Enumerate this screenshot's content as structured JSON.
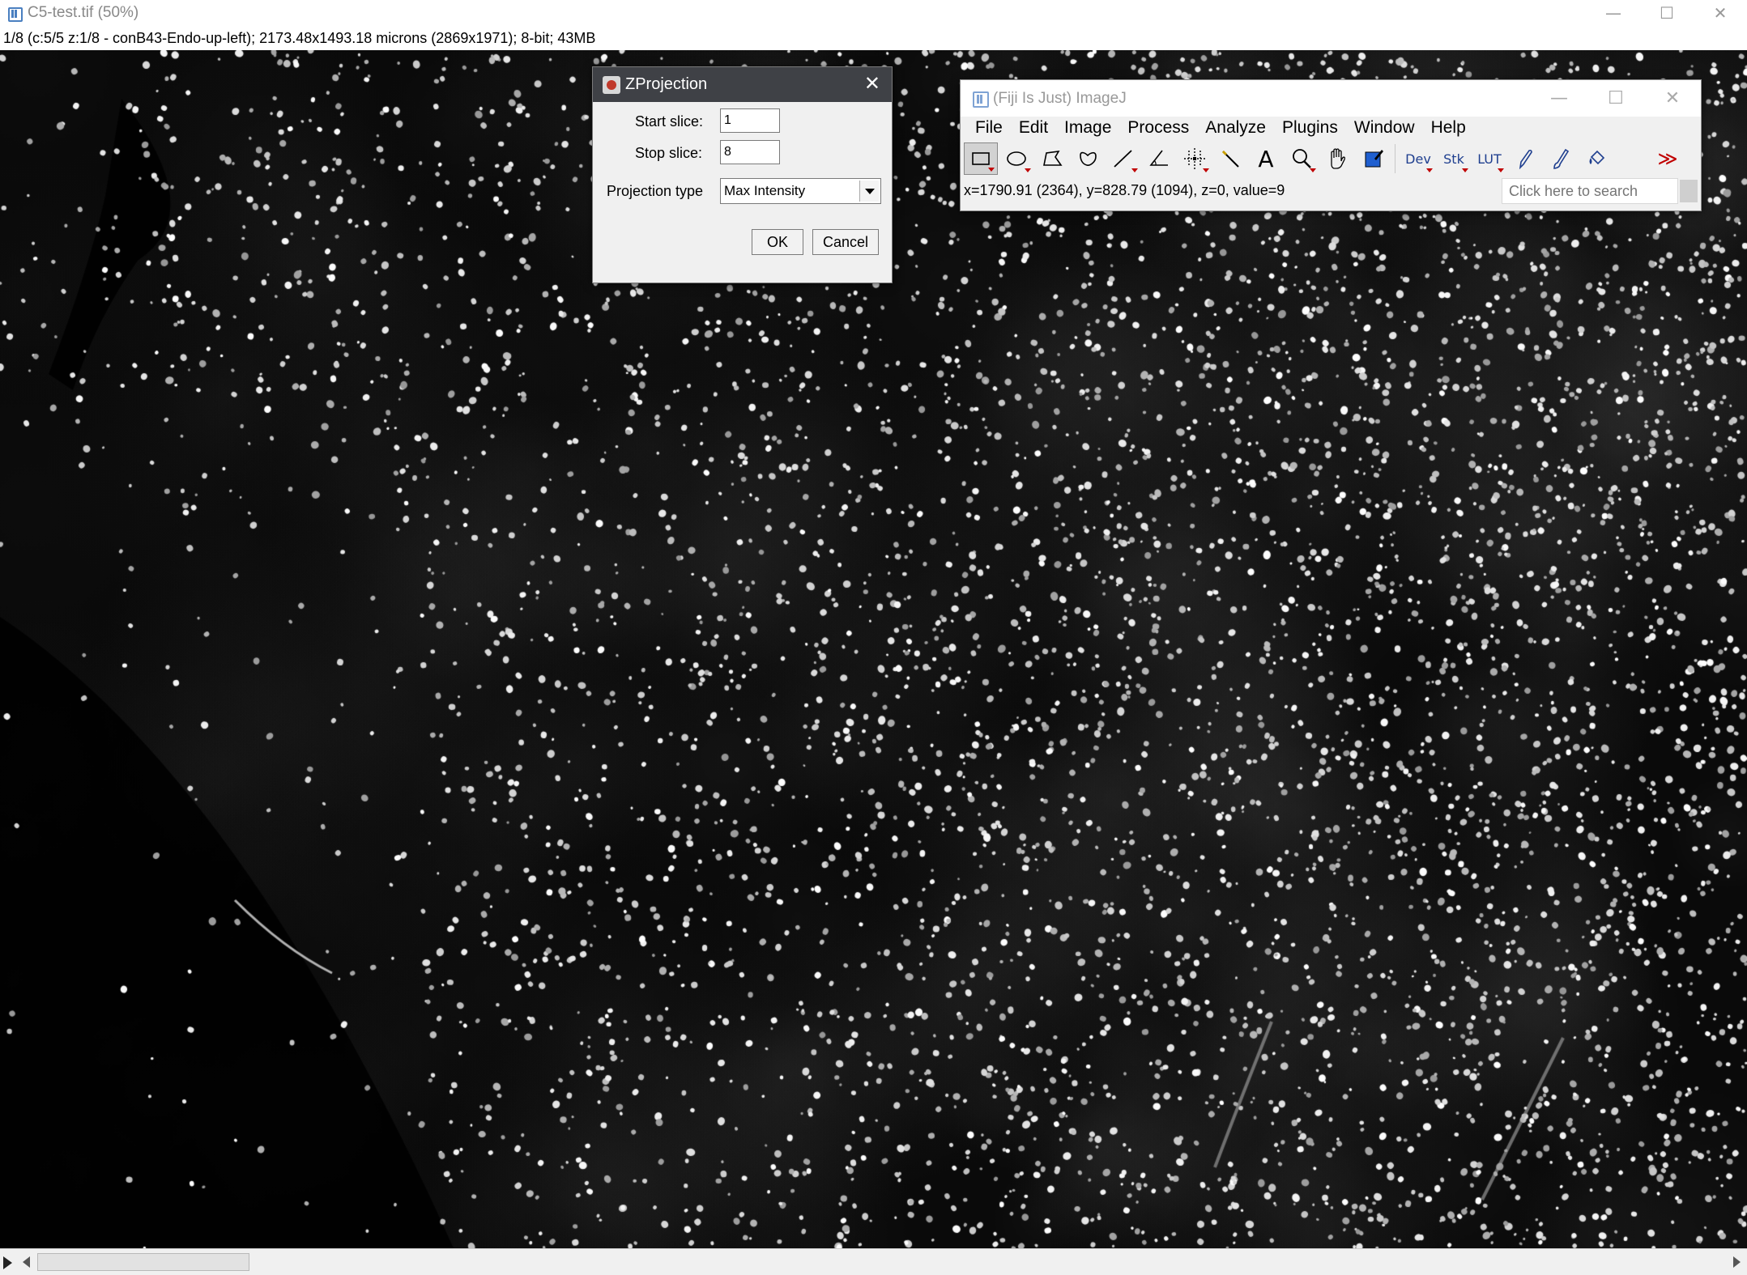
{
  "main_window": {
    "title": "C5-test.tif (50%)",
    "info": "1/8 (c:5/5 z:1/8 - conB43-Endo-up-left); 2173.48x1493.18 microns (2869x1971); 8-bit; 43MB",
    "controls": {
      "minimize": "—",
      "maximize": "☐",
      "close": "✕"
    }
  },
  "dialog": {
    "title": "ZProjection",
    "close": "✕",
    "start_label": "Start slice:",
    "start_value": "1",
    "stop_label": "Stop slice:",
    "stop_value": "8",
    "projection_label": "Projection type",
    "projection_value": "Max Intensity",
    "ok": "OK",
    "cancel": "Cancel"
  },
  "fiji": {
    "title": "(Fiji Is Just) ImageJ",
    "controls": {
      "minimize": "—",
      "maximize": "☐",
      "close": "✕"
    },
    "menu": [
      "File",
      "Edit",
      "Image",
      "Process",
      "Analyze",
      "Plugins",
      "Window",
      "Help"
    ],
    "tools": {
      "rectangle": "rectangle-icon",
      "oval": "oval-icon",
      "polygon": "polygon-icon",
      "freehand": "freehand-icon",
      "line": "line-icon",
      "angle": "angle-icon",
      "point": "point-icon",
      "wand": "wand-icon",
      "text": "A",
      "magnifier": "magnifier-icon",
      "hand": "hand-icon",
      "color_picker": "color-picker-icon",
      "dev": "Dev",
      "stk": "Stk",
      "lut": "LUT",
      "pencil": "pencil-icon",
      "brush": "brush-icon",
      "flood_fill": "flood-fill-icon",
      "more": "≫"
    },
    "status": "x=1790.91 (2364), y=828.79 (1094), z=0, value=9",
    "search_placeholder": "Click here to search"
  },
  "colors": {
    "tool_accent": "#1f3f8f",
    "menu_arrow": "#c00000",
    "dialog_title_bg": "#3f4146"
  }
}
